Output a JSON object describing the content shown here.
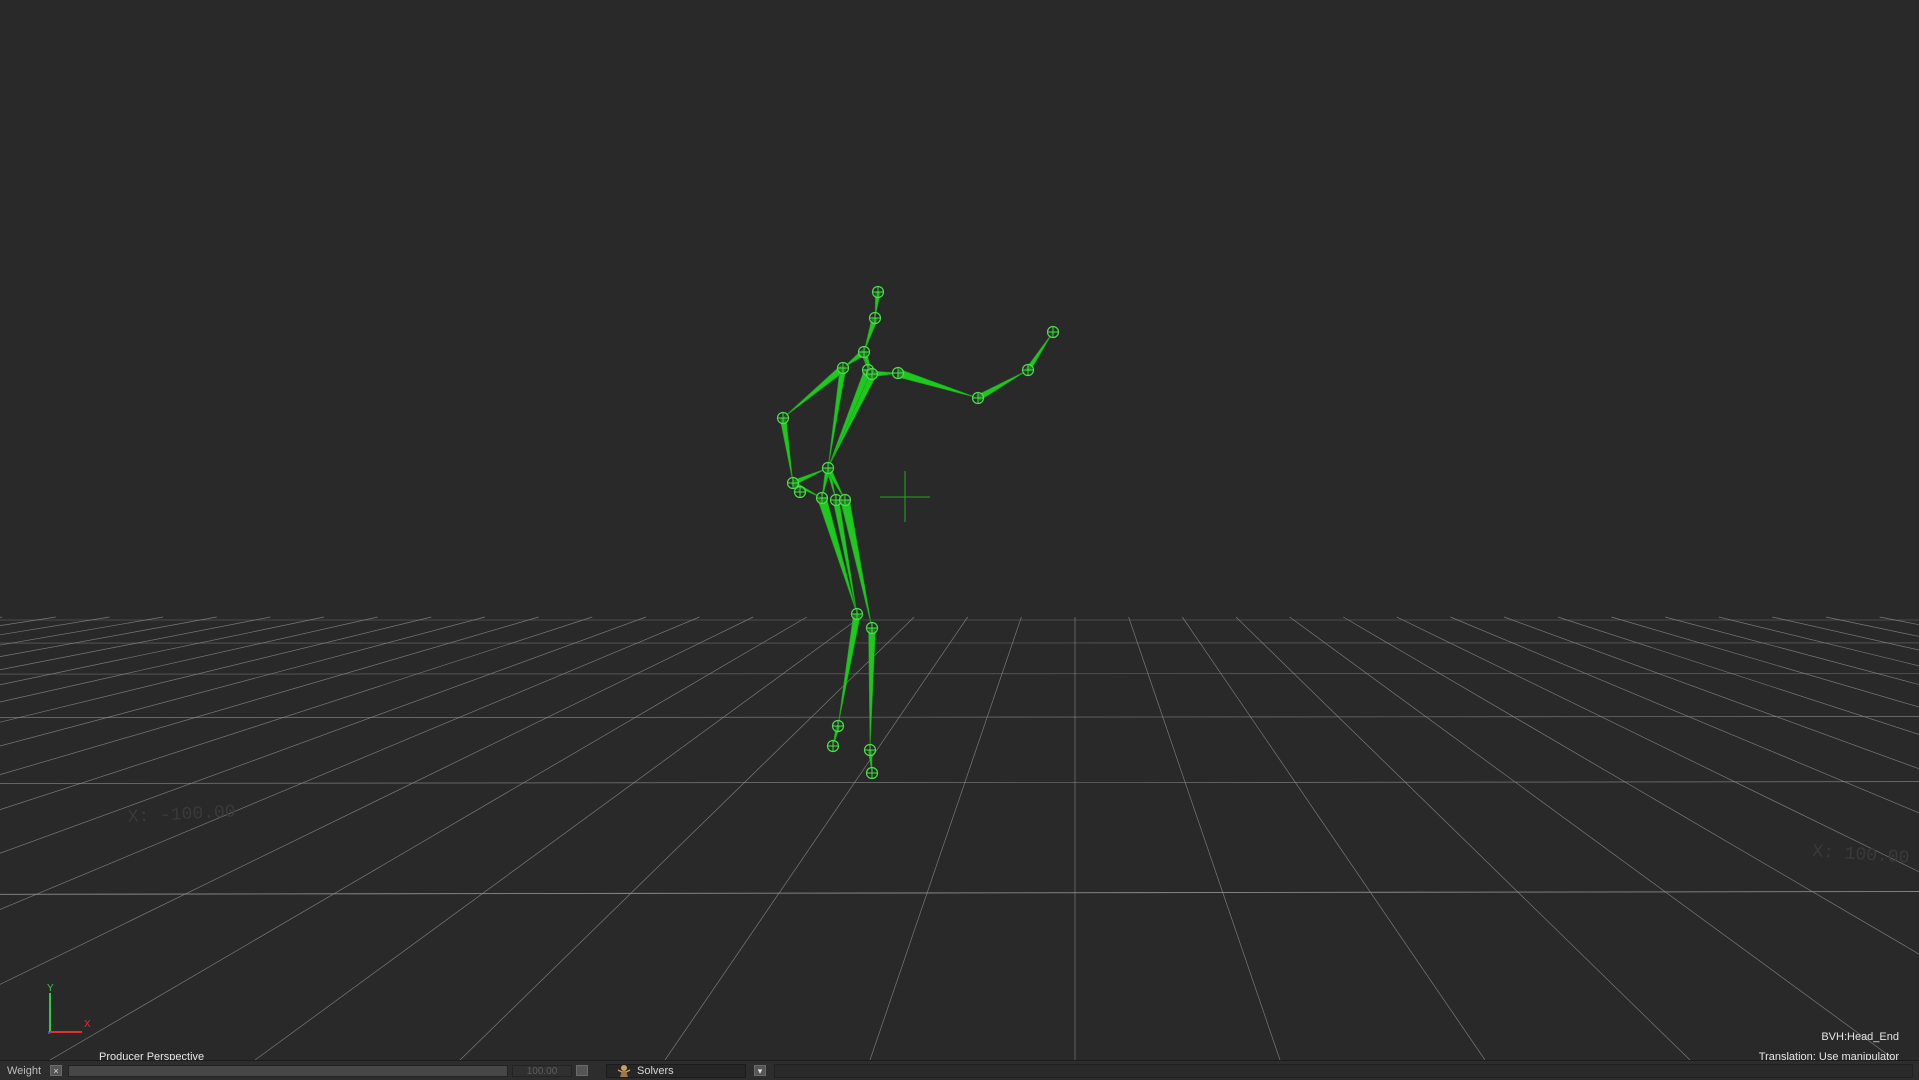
{
  "viewport": {
    "camera_name": "Producer Perspective",
    "selected_object": "BVH:Head_End",
    "manipulator_status": "Translation: Use manipulator",
    "grid_labels": [
      "X: -100.00",
      "X: 100.00"
    ],
    "axis_labels": {
      "y": "Y",
      "x": "X"
    },
    "colors": {
      "background": "#292929",
      "grid": "#9a9a9a",
      "skeleton": "#1ec81e",
      "axis_y": "#2ecc40",
      "axis_x": "#e03030",
      "axis_z": "#3050ff"
    }
  },
  "bottom_bar": {
    "weight_label": "Weight",
    "weight_value": "100.00",
    "weight_fraction": 1.0,
    "solvers_label": "Solvers",
    "solvers_icon": "character-solver-icon",
    "dropdown_icon": "chevron-down-icon"
  }
}
